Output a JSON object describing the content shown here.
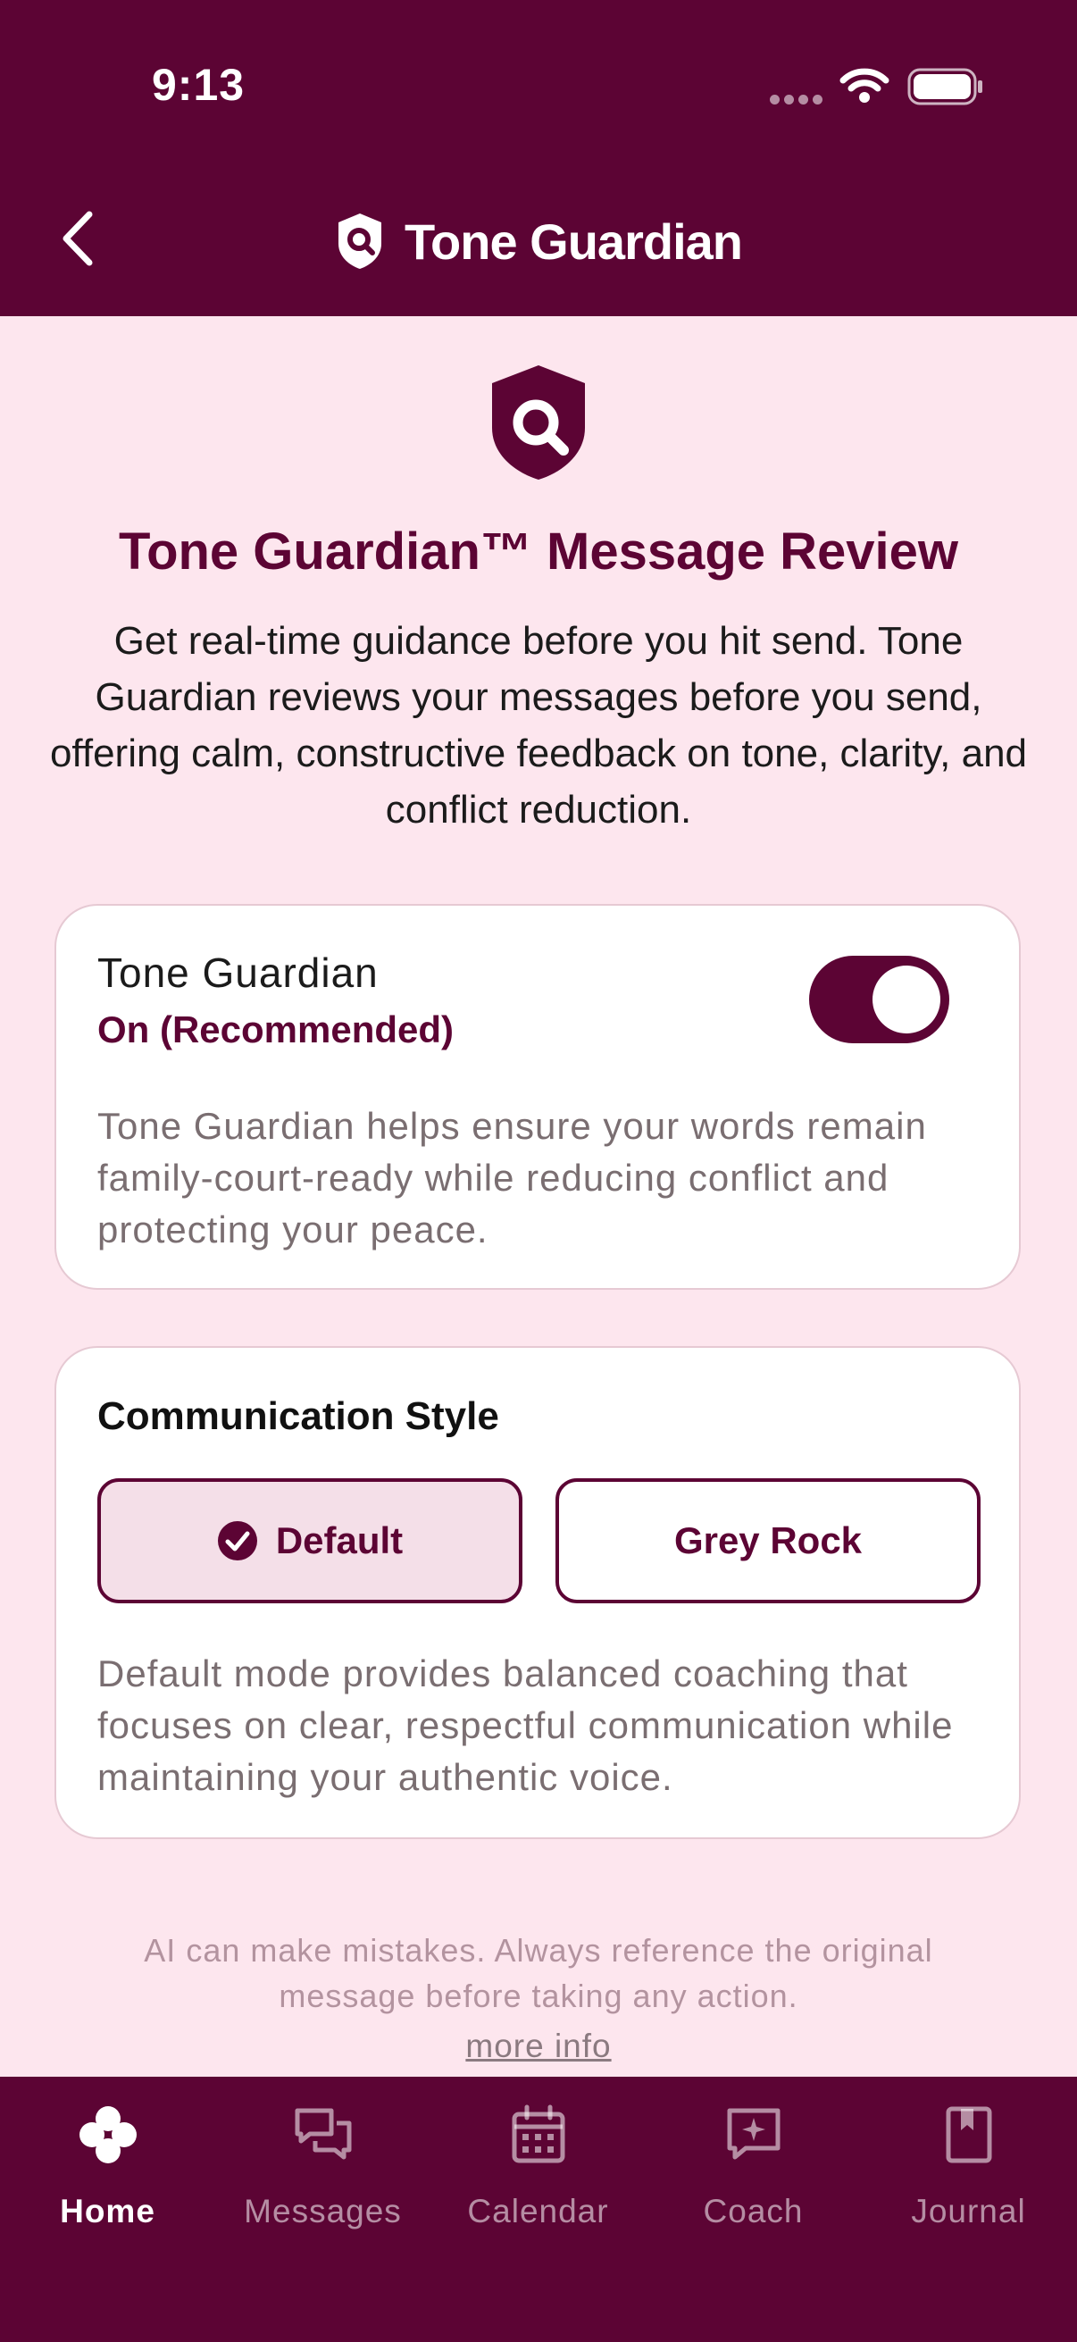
{
  "status_bar": {
    "time": "9:13"
  },
  "header": {
    "title": "Tone Guardian"
  },
  "intro": {
    "title": "Tone Guardian™ Message Review",
    "description": "Get real-time guidance before you hit send. Tone Guardian reviews your messages before you send, offering calm, constructive feedback on tone, clarity, and conflict reduction."
  },
  "tone_guardian_card": {
    "title": "Tone Guardian",
    "state": "On (Recommended)",
    "enabled": true,
    "description": "Tone Guardian helps ensure your words remain family-court-ready while reducing conflict and protecting your peace."
  },
  "communication_style": {
    "title": "Communication Style",
    "options": [
      "Default",
      "Grey Rock"
    ],
    "selected": "Default",
    "description": "Default mode provides balanced coaching that focuses on clear, respectful communication while maintaining your authentic voice."
  },
  "disclaimer": {
    "text": "AI can make mistakes. Always reference the original message before taking any action.",
    "link": "more info"
  },
  "bottom_nav": {
    "items": [
      {
        "label": "Home",
        "icon": "clover-icon",
        "active": true
      },
      {
        "label": "Messages",
        "icon": "chat-bubbles-icon",
        "active": false
      },
      {
        "label": "Calendar",
        "icon": "calendar-icon",
        "active": false
      },
      {
        "label": "Coach",
        "icon": "sparkle-chat-icon",
        "active": false
      },
      {
        "label": "Journal",
        "icon": "journal-bookmark-icon",
        "active": false
      }
    ]
  },
  "colors": {
    "brand": "#5c0434",
    "background": "#fde6ee",
    "card": "#ffffff",
    "selected_option_bg": "#f4dfe8"
  }
}
